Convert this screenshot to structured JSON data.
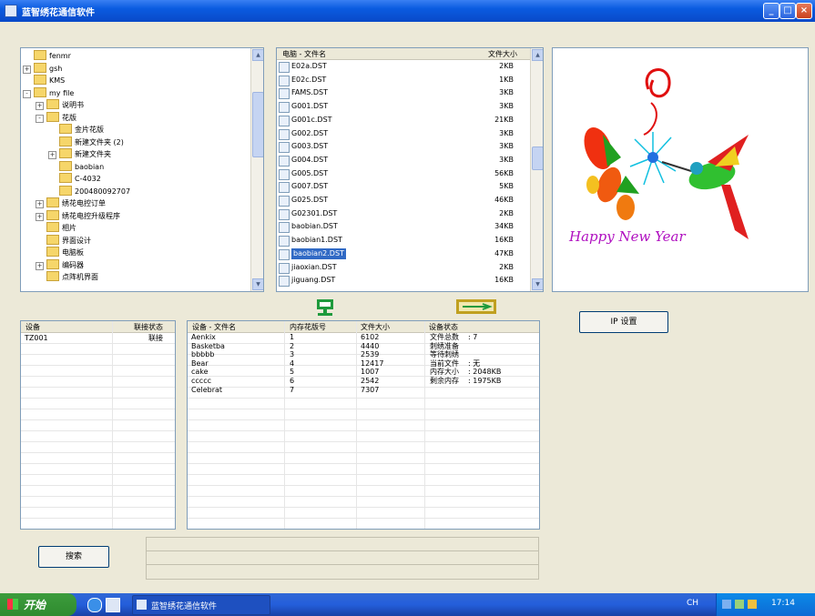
{
  "window": {
    "title": "蓝智绣花通信软件",
    "minimize": "_",
    "maximize": "□",
    "close": "×"
  },
  "tree": {
    "items": [
      {
        "label": "fenmr",
        "exp": ""
      },
      {
        "label": "gsh",
        "exp": "+"
      },
      {
        "label": "KMS",
        "exp": ""
      },
      {
        "label": "my file",
        "exp": "-"
      },
      {
        "label": "说明书",
        "exp": "+"
      },
      {
        "label": "花版",
        "exp": "-"
      },
      {
        "label": "金片花版",
        "exp": ""
      },
      {
        "label": "新建文件夹 (2)",
        "exp": ""
      },
      {
        "label": "新建文件夹",
        "exp": "+"
      },
      {
        "label": "baobian",
        "exp": ""
      },
      {
        "label": "C-4032",
        "exp": ""
      },
      {
        "label": "200480092707",
        "exp": ""
      },
      {
        "label": "绣花电控订单",
        "exp": "+"
      },
      {
        "label": "绣花电控升级程序",
        "exp": "+"
      },
      {
        "label": "相片",
        "exp": ""
      },
      {
        "label": "界面设计",
        "exp": ""
      },
      {
        "label": "电脑板",
        "exp": ""
      },
      {
        "label": "编码器",
        "exp": "+"
      },
      {
        "label": "点阵机界面",
        "exp": ""
      }
    ]
  },
  "filelist": {
    "header_name": "电脑 - 文件名",
    "header_size": "文件大小",
    "files": [
      {
        "name": "E02a.DST",
        "size": "2KB"
      },
      {
        "name": "E02c.DST",
        "size": "1KB"
      },
      {
        "name": "FAMS.DST",
        "size": "3KB"
      },
      {
        "name": "G001.DST",
        "size": "3KB"
      },
      {
        "name": "G001c.DST",
        "size": "21KB"
      },
      {
        "name": "G002.DST",
        "size": "3KB"
      },
      {
        "name": "G003.DST",
        "size": "3KB"
      },
      {
        "name": "G004.DST",
        "size": "3KB"
      },
      {
        "name": "G005.DST",
        "size": "56KB"
      },
      {
        "name": "G007.DST",
        "size": "5KB"
      },
      {
        "name": "G025.DST",
        "size": "46KB"
      },
      {
        "name": "G02301.DST",
        "size": "2KB"
      },
      {
        "name": "baobian.DST",
        "size": "34KB"
      },
      {
        "name": "baobian1.DST",
        "size": "16KB"
      },
      {
        "name": "baobian2.DST",
        "size": "47KB"
      },
      {
        "name": "jiaoxian.DST",
        "size": "2KB"
      },
      {
        "name": "jiguang.DST",
        "size": "16KB"
      }
    ],
    "selected_index": 14
  },
  "preview": {
    "caption": "Happy New Year"
  },
  "device_list": {
    "header_device": "设备",
    "header_status": "联接状态",
    "rows": [
      {
        "device": "TZ001",
        "status": "联接"
      }
    ]
  },
  "device_files": {
    "headers": [
      "设备 - 文件名",
      "内存花版号",
      "文件大小",
      "设备状态"
    ],
    "rows": [
      [
        "Aenkix",
        "1",
        "6102"
      ],
      [
        "Basketba",
        "2",
        "4440"
      ],
      [
        "bbbbb",
        "3",
        "2539"
      ],
      [
        "Bear",
        "4",
        "12417"
      ],
      [
        "cake",
        "5",
        "1007"
      ],
      [
        "ccccc",
        "6",
        "2542"
      ],
      [
        "Celebrat",
        "7",
        "7307"
      ]
    ],
    "status_lines": [
      {
        "label": "文件总数",
        "value": ": 7"
      },
      {
        "label": "刺绣准备",
        "value": ""
      },
      {
        "label": "等待刺绣",
        "value": ""
      },
      {
        "label": "当前文件",
        "value": ": 无"
      },
      {
        "label": "内存大小",
        "value": ": 2048KB"
      },
      {
        "label": "剩余内存",
        "value": ": 1975KB"
      }
    ]
  },
  "buttons": {
    "ip_settings": "IP 设置",
    "search": "搜索"
  },
  "taskbar": {
    "start": "开始",
    "task": "蓝智绣花通信软件",
    "lang": "CH",
    "clock": "17:14"
  }
}
